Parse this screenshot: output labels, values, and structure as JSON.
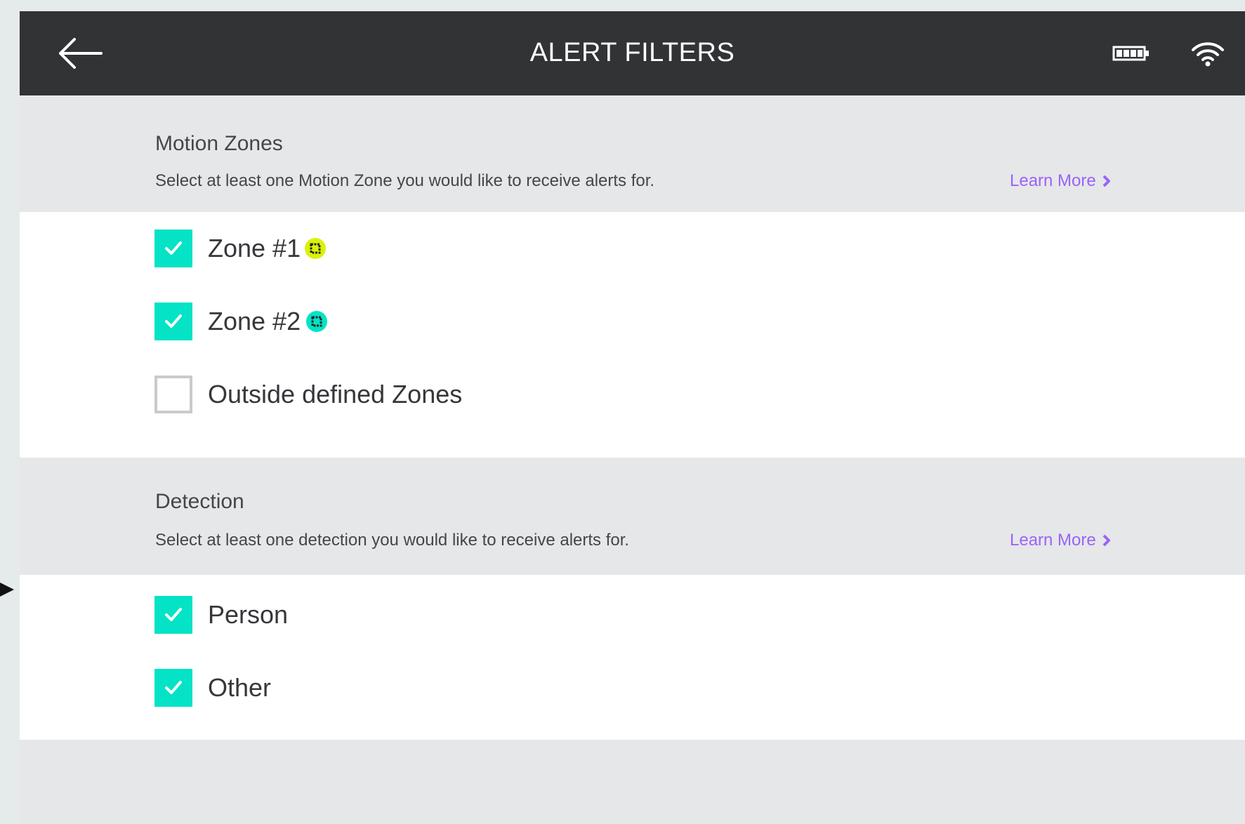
{
  "header": {
    "title": "ALERT FILTERS",
    "back_icon": "arrow-left-icon",
    "battery_icon": "battery-icon",
    "wifi_icon": "wifi-icon"
  },
  "motion_zones": {
    "title": "Motion Zones",
    "description": "Select at least one Motion Zone you would like to receive alerts for.",
    "learn_more": "Learn More",
    "items": [
      {
        "label": "Zone #1",
        "checked": true,
        "zone_color": "#d9f20a"
      },
      {
        "label": "Zone #2",
        "checked": true,
        "zone_color": "#04e3c6"
      },
      {
        "label": "Outside defined Zones",
        "checked": false
      }
    ]
  },
  "detection": {
    "title": "Detection",
    "description": "Select at least one detection you would like to receive alerts for.",
    "learn_more": "Learn More",
    "items": [
      {
        "label": "Person",
        "checked": true
      },
      {
        "label": "Other",
        "checked": true
      }
    ]
  },
  "colors": {
    "header_bg": "#313335",
    "accent_check": "#04e3c6",
    "link": "#9b63f8",
    "section_bg": "#e6e7e9"
  }
}
